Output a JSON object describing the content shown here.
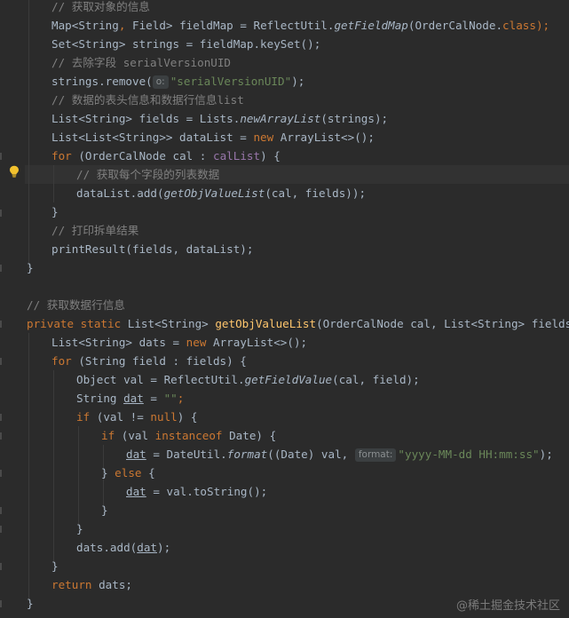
{
  "code": {
    "l1_comment": "// 获取对象的信息",
    "l2_a": "Map<String",
    "l2_comma": ",",
    "l2_b": " Field> fieldMap = ReflectUtil.",
    "l2_method": "getFieldMap",
    "l2_c": "(OrderCalNode.",
    "l2_kw": "class",
    "l2_d": ");",
    "l3": "Set<String> strings = fieldMap.keySet();",
    "l4_comment": "// 去除字段 serialVersionUID",
    "l5_a": "strings.remove(",
    "l5_hint": "o:",
    "l5_str": "\"serialVersionUID\"",
    "l5_b": ");",
    "l6_comment": "// 数据的表头信息和数据行信息list",
    "l7_a": "List<String> fields = Lists.",
    "l7_method": "newArrayList",
    "l7_b": "(strings);",
    "l8_a": "List<List<String>> dataList = ",
    "l8_kw": "new",
    "l8_b": " ArrayList<>();",
    "l9_kw": "for",
    "l9_a": " (OrderCalNode cal : ",
    "l9_field": "calList",
    "l9_b": ") {",
    "l10_comment": "// 获取每个字段的列表数据",
    "l11_a": "dataList.add(",
    "l11_method": "getObjValueList",
    "l11_b": "(cal, fields));",
    "l12": "}",
    "l13_comment": "// 打印拆单结果",
    "l14_a": "printResult(fields, dataList);",
    "l15": "}",
    "l17_comment": "// 获取数据行信息",
    "l18_kw1": "private",
    "l18_kw2": "static",
    "l18_a": "List<String> ",
    "l18_fn": "getObjValueList",
    "l18_b": "(OrderCalNode cal, List<String> fields) {",
    "l19_a": "List<String> dats = ",
    "l19_kw": "new",
    "l19_b": " ArrayList<>();",
    "l20_kw": "for",
    "l20_a": " (String field : fields) {",
    "l21_a": "Object val = ReflectUtil.",
    "l21_method": "getFieldValue",
    "l21_b": "(cal, field);",
    "l22_a": "String ",
    "l22_var": "dat",
    "l22_b": " = ",
    "l22_str": "\"\"",
    "l22_c": ";",
    "l23_kw": "if",
    "l23_a": " (val != ",
    "l23_null": "null",
    "l23_b": ") {",
    "l24_kw": "if",
    "l24_a": " (val ",
    "l24_inst": "instanceof",
    "l24_b": " Date) {",
    "l25_var": "dat",
    "l25_a": " = DateUtil.",
    "l25_method": "format",
    "l25_b": "((Date) val, ",
    "l25_hint": "format:",
    "l25_str": "\"yyyy-MM-dd HH:mm:ss\"",
    "l25_c": ");",
    "l26_a": "} ",
    "l26_kw": "else",
    "l26_b": " {",
    "l27_var": "dat",
    "l27_a": " = val.toString();",
    "l28": "}",
    "l29": "}",
    "l30_a": "dats.add(",
    "l30_var": "dat",
    "l30_b": ");",
    "l31": "}",
    "l32_kw": "return",
    "l32_a": " dats;",
    "l33": "}"
  },
  "watermark": "@稀土掘金技术社区",
  "icons": {
    "intention": "lightbulb-icon"
  },
  "colors": {
    "background": "#2b2b2b",
    "text": "#a9b7c6",
    "keyword": "#cc7832",
    "comment": "#808080",
    "string": "#6a8759",
    "method_decl": "#ffc66d",
    "field": "#9876aa"
  }
}
